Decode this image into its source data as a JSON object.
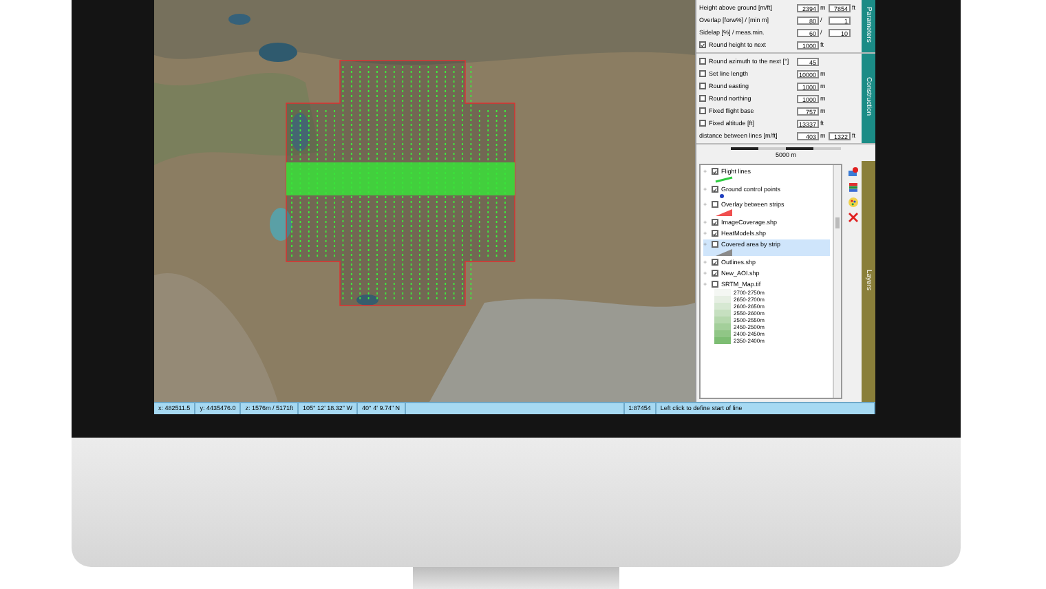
{
  "parameters": {
    "tab": "Parameters",
    "rows": [
      {
        "label": "Height above ground [m/ft]",
        "cells": [
          {
            "kind": "field",
            "text": "2394"
          },
          {
            "kind": "unit",
            "text": "m"
          },
          {
            "kind": "field",
            "text": "7854"
          },
          {
            "kind": "unit",
            "text": "ft"
          }
        ]
      },
      {
        "label": "Overlap [forw%] / [min m]",
        "cells": [
          {
            "kind": "field",
            "text": "80"
          },
          {
            "kind": "unit",
            "text": "/"
          },
          {
            "kind": "field",
            "text": "1"
          }
        ]
      },
      {
        "label": "Sidelap [%] / meas.min.",
        "cells": [
          {
            "kind": "field",
            "text": "60"
          },
          {
            "kind": "unit",
            "text": "/"
          },
          {
            "kind": "field",
            "text": "10"
          }
        ]
      },
      {
        "label": "Round height to next",
        "checked": true,
        "cells": [
          {
            "kind": "field",
            "text": "1000"
          },
          {
            "kind": "unit",
            "text": "ft"
          }
        ]
      }
    ]
  },
  "construction": {
    "tab": "Construction",
    "rows": [
      {
        "label": "Round azimuth to the next [°]",
        "checked": false,
        "cells": [
          {
            "kind": "field",
            "text": "45"
          }
        ]
      },
      {
        "label": "Set line length",
        "checked": false,
        "cells": [
          {
            "kind": "field",
            "text": "10000"
          },
          {
            "kind": "unit",
            "text": "m"
          }
        ]
      },
      {
        "label": "Round easting",
        "checked": false,
        "cells": [
          {
            "kind": "field",
            "text": "1000"
          },
          {
            "kind": "unit",
            "text": "m"
          }
        ]
      },
      {
        "label": "Round northing",
        "checked": false,
        "cells": [
          {
            "kind": "field",
            "text": "1000"
          },
          {
            "kind": "unit",
            "text": "m"
          }
        ]
      },
      {
        "label": "Fixed flight base",
        "checked": false,
        "cells": [
          {
            "kind": "field",
            "text": "757"
          },
          {
            "kind": "unit",
            "text": "m"
          }
        ]
      },
      {
        "label": "Fixed altitude [ft]",
        "checked": false,
        "cells": [
          {
            "kind": "field",
            "text": "13337"
          },
          {
            "kind": "unit",
            "text": "ft"
          }
        ]
      },
      {
        "label": "distance between lines [m/ft]",
        "cells": [
          {
            "kind": "field",
            "text": "403"
          },
          {
            "kind": "unit",
            "text": "m"
          },
          {
            "kind": "field",
            "text": "1322"
          },
          {
            "kind": "unit",
            "text": "ft"
          }
        ]
      }
    ]
  },
  "scale_bar": {
    "label": "5000 m"
  },
  "layers": {
    "tab": "Layers",
    "items": [
      {
        "expander": "+",
        "label": "Flight lines",
        "checked": true,
        "selected": false,
        "kind": "line",
        "color": "#2ecc40"
      },
      {
        "expander": "+",
        "label": "Ground control points",
        "checked": true,
        "selected": false,
        "kind": "dot",
        "color": "#1f3fbf"
      },
      {
        "expander": "+",
        "label": "Overlay between strips",
        "checked": false,
        "selected": false,
        "kind": "wedge",
        "color": "#f05050"
      },
      {
        "expander": "+",
        "label": "ImageCoverage.shp",
        "checked": true,
        "selected": false
      },
      {
        "expander": "+",
        "label": "HeatModels.shp",
        "checked": true,
        "selected": false
      },
      {
        "expander": "+",
        "label": "Covered area by strip",
        "checked": false,
        "selected": true,
        "kind": "wedge",
        "color": "#8a8a8a"
      },
      {
        "expander": "+",
        "label": "Outlines.shp",
        "checked": true,
        "selected": false
      },
      {
        "expander": "+",
        "label": "New_AOI.shp",
        "checked": true,
        "selected": false
      },
      {
        "expander": "+",
        "label": "SRTM_Map.tif",
        "checked": false,
        "selected": false,
        "legend_entries": [
          {
            "label": "2700-2750m",
            "color": "#f4f7f3"
          },
          {
            "label": "2650-2700m",
            "color": "#e6efe3"
          },
          {
            "label": "2600-2650m",
            "color": "#d6e8d2"
          },
          {
            "label": "2550-2600m",
            "color": "#c6e0c0"
          },
          {
            "label": "2500-2550m",
            "color": "#b5d8ad"
          },
          {
            "label": "2450-2500m",
            "color": "#a3cf9a"
          },
          {
            "label": "2400-2450m",
            "color": "#90c686"
          },
          {
            "label": "2350-2400m",
            "color": "#7dbd73"
          }
        ]
      }
    ]
  },
  "status_bar": [
    "x: 482511.5",
    "y: 4435476.0",
    "z: 1576m / 5171ft",
    "105° 12' 18.32\"  W",
    "40° 4' 9.74\"  N",
    "1:87454",
    "Left click to define start of line"
  ]
}
